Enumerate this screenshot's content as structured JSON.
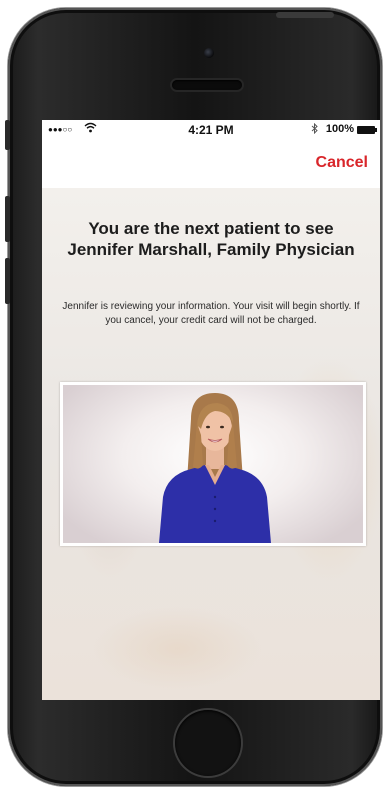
{
  "status_bar": {
    "signal": "●●●○○",
    "wifi_icon": "wifi-icon",
    "time": "4:21 PM",
    "bluetooth_icon": "bluetooth-icon",
    "battery_percent": "100%"
  },
  "nav": {
    "cancel_label": "Cancel"
  },
  "waiting": {
    "headline": "You are the next patient to see Jennifer Marshall, Family Physician",
    "message": "Jennifer is reviewing your information. Your visit will begin shortly. If you cancel, your credit card will not be charged."
  },
  "colors": {
    "accent_red": "#d9262b",
    "headline_text": "#1d1d1d"
  }
}
